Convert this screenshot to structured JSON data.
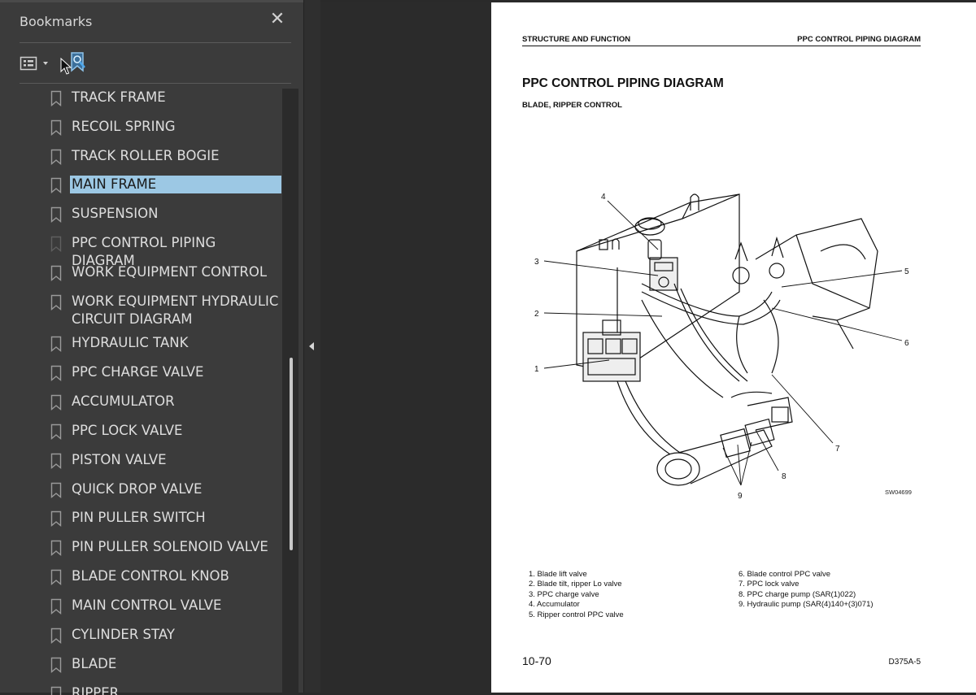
{
  "bookmarks_panel": {
    "title": "Bookmarks",
    "close_icon": "close-icon",
    "options_icon": "list-options-icon",
    "find_icon": "find-current-bookmark-icon",
    "items": [
      {
        "label": "TRACK FRAME"
      },
      {
        "label": "RECOIL SPRING"
      },
      {
        "label": "TRACK ROLLER BOGIE"
      },
      {
        "label": "MAIN FRAME",
        "selected": true
      },
      {
        "label": "SUSPENSION"
      },
      {
        "label": "PPC CONTROL PIPING DIAGRAM"
      },
      {
        "label": "WORK EQUIPMENT CONTROL"
      },
      {
        "label": "WORK EQUIPMENT HYDRAULIC\nCIRCUIT DIAGRAM"
      },
      {
        "label": "HYDRAULIC TANK"
      },
      {
        "label": "PPC CHARGE VALVE"
      },
      {
        "label": "ACCUMULATOR"
      },
      {
        "label": "PPC LOCK VALVE"
      },
      {
        "label": "PISTON VALVE"
      },
      {
        "label": "QUICK DROP VALVE"
      },
      {
        "label": "PIN PULLER SWITCH"
      },
      {
        "label": "PIN PULLER SOLENOID VALVE"
      },
      {
        "label": "BLADE CONTROL KNOB"
      },
      {
        "label": "MAIN CONTROL VALVE"
      },
      {
        "label": "CYLINDER STAY"
      },
      {
        "label": "BLADE"
      },
      {
        "label": "RIPPER"
      }
    ],
    "selected_color": "#9cc8e4"
  },
  "document": {
    "header_left": "STRUCTURE AND FUNCTION",
    "header_right": "PPC CONTROL PIPING DIAGRAM",
    "title": "PPC CONTROL PIPING DIAGRAM",
    "subtitle": "BLADE, RIPPER CONTROL",
    "figure_code": "SW04699",
    "callouts": [
      "1",
      "2",
      "3",
      "4",
      "5",
      "6",
      "7",
      "8",
      "9"
    ],
    "legend_left": [
      "1. Blade lift valve",
      "2. Blade tilt, ripper Lo valve",
      "3. PPC charge valve",
      "4. Accumulator",
      "5. Ripper control PPC valve"
    ],
    "legend_right": [
      "6. Blade control PPC valve",
      "7. PPC lock valve",
      "8. PPC charge pump (SAR(1)022)",
      "9. Hydraulic pump (SAR(4)140+(3)071)"
    ],
    "page_number": "10-70",
    "model": "D375A-5"
  }
}
